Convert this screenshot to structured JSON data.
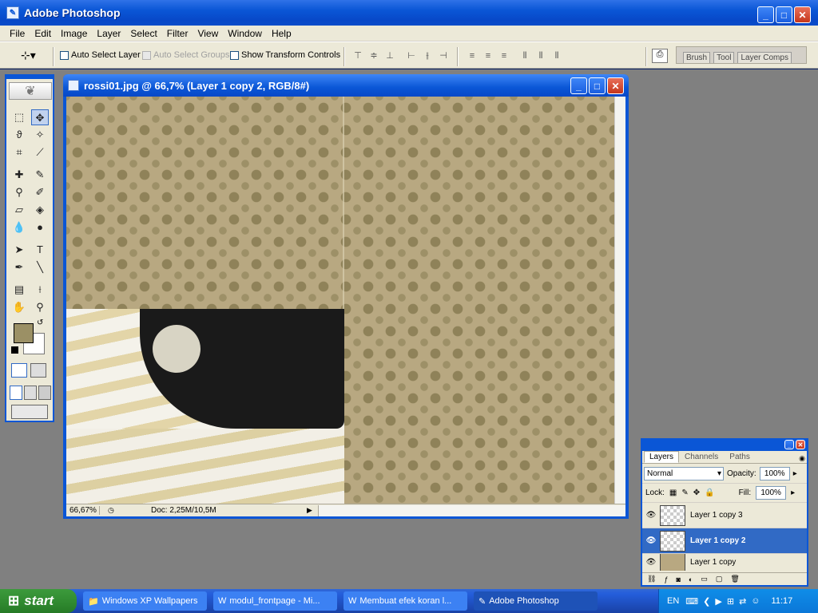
{
  "app": {
    "title": "Adobe Photoshop"
  },
  "menu": [
    "File",
    "Edit",
    "Image",
    "Layer",
    "Select",
    "Filter",
    "View",
    "Window",
    "Help"
  ],
  "options": {
    "auto_select_layer": "Auto Select Layer",
    "auto_select_groups": "Auto Select Groups",
    "show_transform_controls": "Show Transform Controls"
  },
  "palette_well": [
    "Brush",
    "Tool",
    "Layer Comps"
  ],
  "document": {
    "title": "rossi01.jpg @ 66,7% (Layer 1 copy 2, RGB/8#)",
    "zoom": "66,67%",
    "doc_size": "Doc: 2,25M/10,5M"
  },
  "layers_panel": {
    "tabs": [
      "Layers",
      "Channels",
      "Paths"
    ],
    "blend_mode": "Normal",
    "opacity_label": "Opacity:",
    "opacity": "100%",
    "lock_label": "Lock:",
    "fill_label": "Fill:",
    "fill": "100%",
    "layers": [
      {
        "name": "Layer 1 copy 3",
        "selected": false
      },
      {
        "name": "Layer 1 copy 2",
        "selected": true
      },
      {
        "name": "Layer 1 copy",
        "selected": false
      }
    ]
  },
  "colors": {
    "foreground": "#9b9065",
    "background": "#ffffff"
  },
  "taskbar": {
    "start": "start",
    "tasks": [
      {
        "label": "Windows XP Wallpapers",
        "icon": "folder-icon"
      },
      {
        "label": "modul_frontpage - Mi...",
        "icon": "word-icon"
      },
      {
        "label": "Membuat efek koran l...",
        "icon": "word-icon"
      },
      {
        "label": "Adobe Photoshop",
        "icon": "photoshop-icon"
      }
    ],
    "lang": "EN",
    "clock": "11:17"
  }
}
